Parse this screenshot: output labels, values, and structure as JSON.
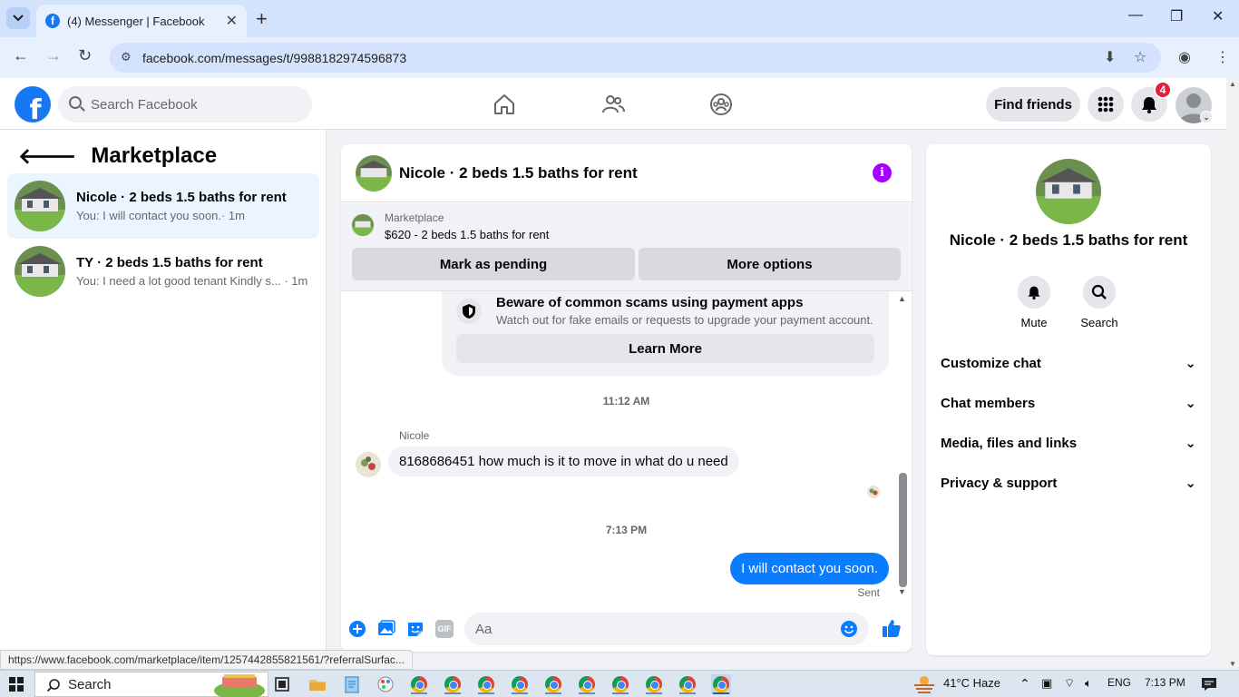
{
  "browser": {
    "tab_title": "(4) Messenger | Facebook",
    "url": "facebook.com/messages/t/9988182974596873",
    "status_url": "https://www.facebook.com/marketplace/item/1257442855821561/?referralSurfac..."
  },
  "header": {
    "search_placeholder": "Search Facebook",
    "find_friends": "Find friends",
    "notification_count": "4"
  },
  "sidebar": {
    "title": "Marketplace",
    "conversations": [
      {
        "name": "Nicole · 2 beds 1.5 baths for rent",
        "preview": "You: I will contact you soon.· 1m"
      },
      {
        "name": "TY · 2 beds 1.5 baths for rent",
        "preview": "You: I need a lot good tenant Kindly s... · 1m"
      }
    ]
  },
  "chat": {
    "title": "Nicole · 2 beds 1.5 baths for rent",
    "marketplace_label": "Marketplace",
    "listing": "$620 - 2 beds 1.5 baths for rent",
    "mark_pending": "Mark as pending",
    "more_options": "More options",
    "scam_title": "Beware of common scams using payment apps",
    "scam_sub": "Watch out for fake emails or requests to upgrade your payment account.",
    "learn_more": "Learn More",
    "time1": "11:12 AM",
    "sender": "Nicole",
    "incoming_message": "8168686451 how much is it to move in what do u need",
    "time2": "7:13 PM",
    "outgoing_message": "I will contact you soon.",
    "sent_label": "Sent",
    "composer_placeholder": "Aa"
  },
  "info_panel": {
    "title": "Nicole · 2 beds 1.5 baths for rent",
    "mute": "Mute",
    "search": "Search",
    "sections": [
      "Customize chat",
      "Chat members",
      "Media, files and links",
      "Privacy & support"
    ]
  },
  "taskbar": {
    "search": "Search",
    "weather": "41°C  Haze",
    "lang": "ENG",
    "time": "7:13 PM"
  },
  "colors": {
    "brand": "#1877f2",
    "outgoing_bubble": "#0a7cff",
    "info_accent": "#a400ff"
  }
}
